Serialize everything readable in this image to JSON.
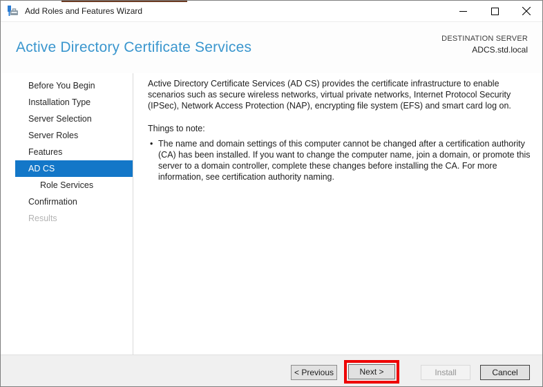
{
  "window": {
    "title": "Add Roles and Features Wizard"
  },
  "header": {
    "page_title": "Active Directory Certificate Services",
    "destination_label": "DESTINATION SERVER",
    "destination_server": "ADCS.std.local"
  },
  "sidebar": {
    "items": [
      {
        "label": "Before You Begin",
        "state": "normal"
      },
      {
        "label": "Installation Type",
        "state": "normal"
      },
      {
        "label": "Server Selection",
        "state": "normal"
      },
      {
        "label": "Server Roles",
        "state": "normal"
      },
      {
        "label": "Features",
        "state": "normal"
      },
      {
        "label": "AD CS",
        "state": "selected"
      },
      {
        "label": "Role Services",
        "state": "child"
      },
      {
        "label": "Confirmation",
        "state": "normal"
      },
      {
        "label": "Results",
        "state": "disabled"
      }
    ]
  },
  "content": {
    "intro": "Active Directory Certificate Services (AD CS) provides the certificate infrastructure to enable scenarios such as secure wireless networks, virtual private networks, Internet Protocol Security (IPSec), Network Access Protection (NAP), encrypting file system (EFS) and smart card log on.",
    "note_heading": "Things to note:",
    "bullet_glyph": "•",
    "bullets": [
      "The name and domain settings of this computer cannot be changed after a certification authority (CA) has been installed. If you want to change the computer name, join a domain, or promote this server to a domain controller, complete these changes before installing the CA. For more information, see certification authority naming."
    ]
  },
  "footer": {
    "previous_label": "< Previous",
    "next_label": "Next >",
    "install_label": "Install",
    "cancel_label": "Cancel"
  },
  "annotation": {
    "highlighted_control": "next-button"
  },
  "colors": {
    "accent_blue": "#1377c8",
    "title_blue": "#3a96ce",
    "annotation_red": "#ee0000",
    "footer_gray": "#f0f0f0"
  }
}
